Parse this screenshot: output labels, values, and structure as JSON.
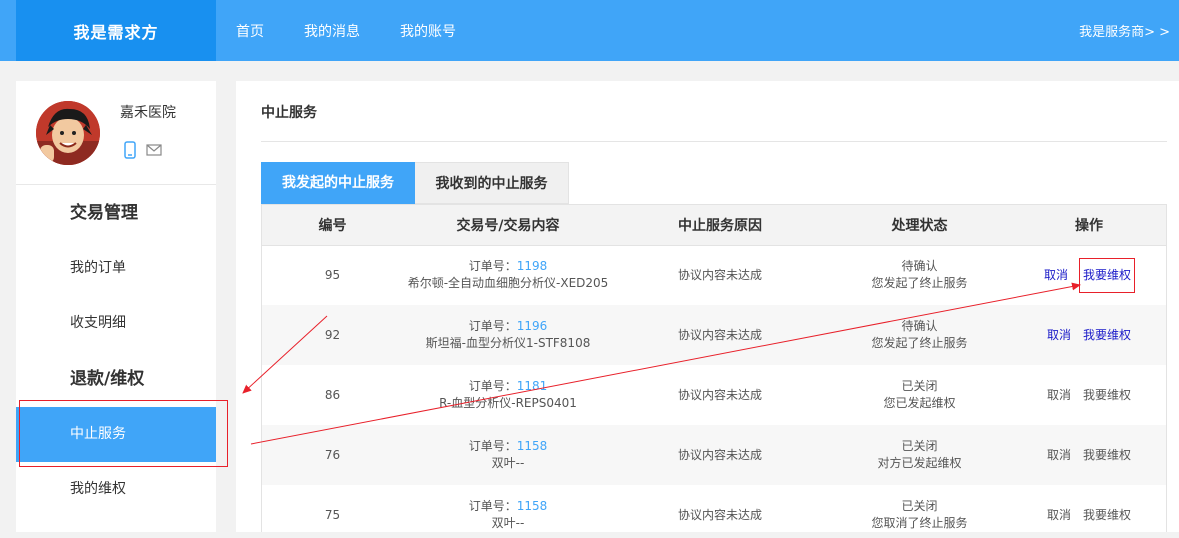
{
  "header": {
    "brand": "我是需求方",
    "nav": [
      "首页",
      "我的消息",
      "我的账号"
    ],
    "switch_role": "我是服务商> >"
  },
  "sidebar": {
    "username": "嘉禾医院",
    "groups": [
      {
        "title": "交易管理",
        "items": [
          "我的订单",
          "收支明细"
        ]
      },
      {
        "title": "退款/维权",
        "items": [
          "中止服务",
          "我的维权"
        ]
      }
    ],
    "active_item": "中止服务"
  },
  "main": {
    "title": "中止服务",
    "tabs": [
      "我发起的中止服务",
      "我收到的中止服务"
    ],
    "active_tab": "我发起的中止服务",
    "table": {
      "columns": [
        "编号",
        "交易号/交易内容",
        "中止服务原因",
        "处理状态",
        "操作"
      ],
      "order_prefix": "订单号：",
      "rows": [
        {
          "id": "95",
          "order_no": "1198",
          "content": "希尔顿-全自动血细胞分析仪-XED205",
          "reason": "协议内容未达成",
          "status1": "待确认",
          "status2": "您发起了终止服务",
          "cancel": "取消",
          "rights": "我要维权",
          "enabled": true
        },
        {
          "id": "92",
          "order_no": "1196",
          "content": "斯坦福-血型分析仪1-STF8108",
          "reason": "协议内容未达成",
          "status1": "待确认",
          "status2": "您发起了终止服务",
          "cancel": "取消",
          "rights": "我要维权",
          "enabled": true
        },
        {
          "id": "86",
          "order_no": "1181",
          "content": "R-血型分析仪-REPS0401",
          "reason": "协议内容未达成",
          "status1": "已关闭",
          "status2": "您已发起维权",
          "cancel": "取消",
          "rights": "我要维权",
          "enabled": false
        },
        {
          "id": "76",
          "order_no": "1158",
          "content": "双叶--",
          "reason": "协议内容未达成",
          "status1": "已关闭",
          "status2": "对方已发起维权",
          "cancel": "取消",
          "rights": "我要维权",
          "enabled": false
        },
        {
          "id": "75",
          "order_no": "1158",
          "content": "双叶--",
          "reason": "协议内容未达成",
          "status1": "已关闭",
          "status2": "您取消了终止服务",
          "cancel": "取消",
          "rights": "我要维权",
          "enabled": false
        }
      ]
    }
  },
  "colors": {
    "primary": "#40a5f8",
    "brand_bg": "#1890f0",
    "annotation": "#e8202a"
  }
}
